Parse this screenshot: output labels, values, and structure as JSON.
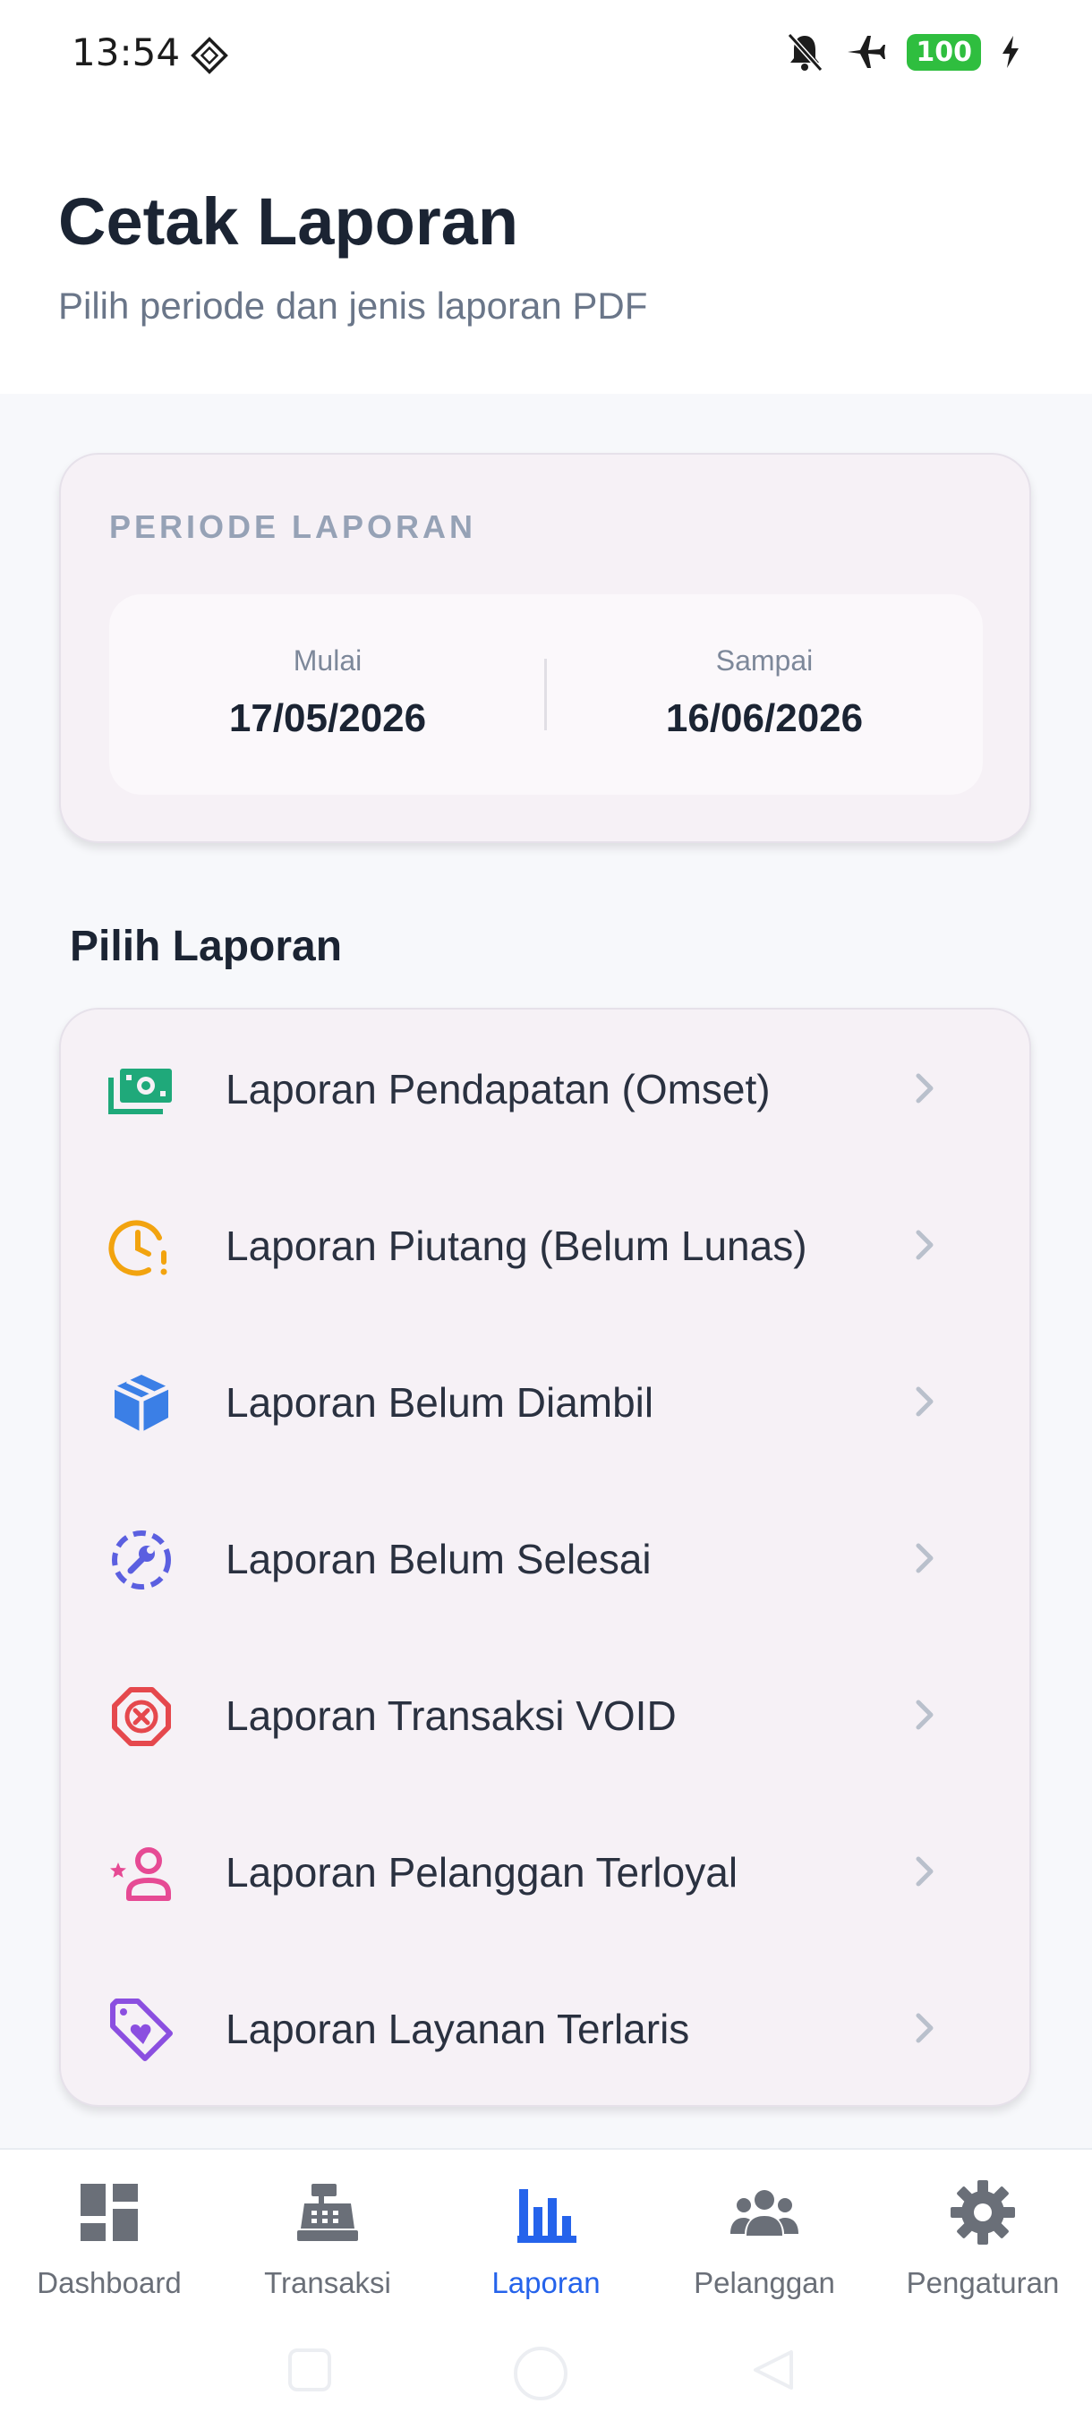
{
  "status_bar": {
    "time": "13:54",
    "battery": "100",
    "icons": [
      "notifications-off-icon",
      "airplane-mode-icon",
      "battery-icon",
      "charging-icon"
    ]
  },
  "header": {
    "title": "Cetak Laporan",
    "subtitle": "Pilih periode dan jenis laporan PDF"
  },
  "period": {
    "label": "PERIODE LAPORAN",
    "start_caption": "Mulai",
    "start_value": "17/05/2026",
    "end_caption": "Sampai",
    "end_value": "16/06/2026"
  },
  "reports": {
    "section_title": "Pilih Laporan",
    "items": [
      {
        "label": "Laporan Pendapatan (Omset)",
        "icon": "cash-icon",
        "color": "#1fa97a"
      },
      {
        "label": "Laporan Piutang (Belum Lunas)",
        "icon": "clock-alert-icon",
        "color": "#f2a30f"
      },
      {
        "label": "Laporan Belum Diambil",
        "icon": "box-icon",
        "color": "#3b7fe6"
      },
      {
        "label": "Laporan Belum Selesai",
        "icon": "wrench-progress-icon",
        "color": "#5b5fe0"
      },
      {
        "label": "Laporan Transaksi VOID",
        "icon": "octagon-x-icon",
        "color": "#e5484d"
      },
      {
        "label": "Laporan Pelanggan Terloyal",
        "icon": "user-star-icon",
        "color": "#e64a94"
      },
      {
        "label": "Laporan Layanan Terlaris",
        "icon": "tag-heart-icon",
        "color": "#8b4fe0"
      }
    ]
  },
  "bottom_nav": {
    "items": [
      {
        "label": "Dashboard",
        "icon": "dashboard-icon",
        "active": false
      },
      {
        "label": "Transaksi",
        "icon": "cash-register-icon",
        "active": false
      },
      {
        "label": "Laporan",
        "icon": "bar-chart-icon",
        "active": true
      },
      {
        "label": "Pelanggan",
        "icon": "people-icon",
        "active": false
      },
      {
        "label": "Pengaturan",
        "icon": "gear-icon",
        "active": false
      }
    ]
  },
  "colors": {
    "accent": "#2563eb",
    "nav_inactive": "#6a6f78",
    "card_bg": "#f6f1f6"
  }
}
